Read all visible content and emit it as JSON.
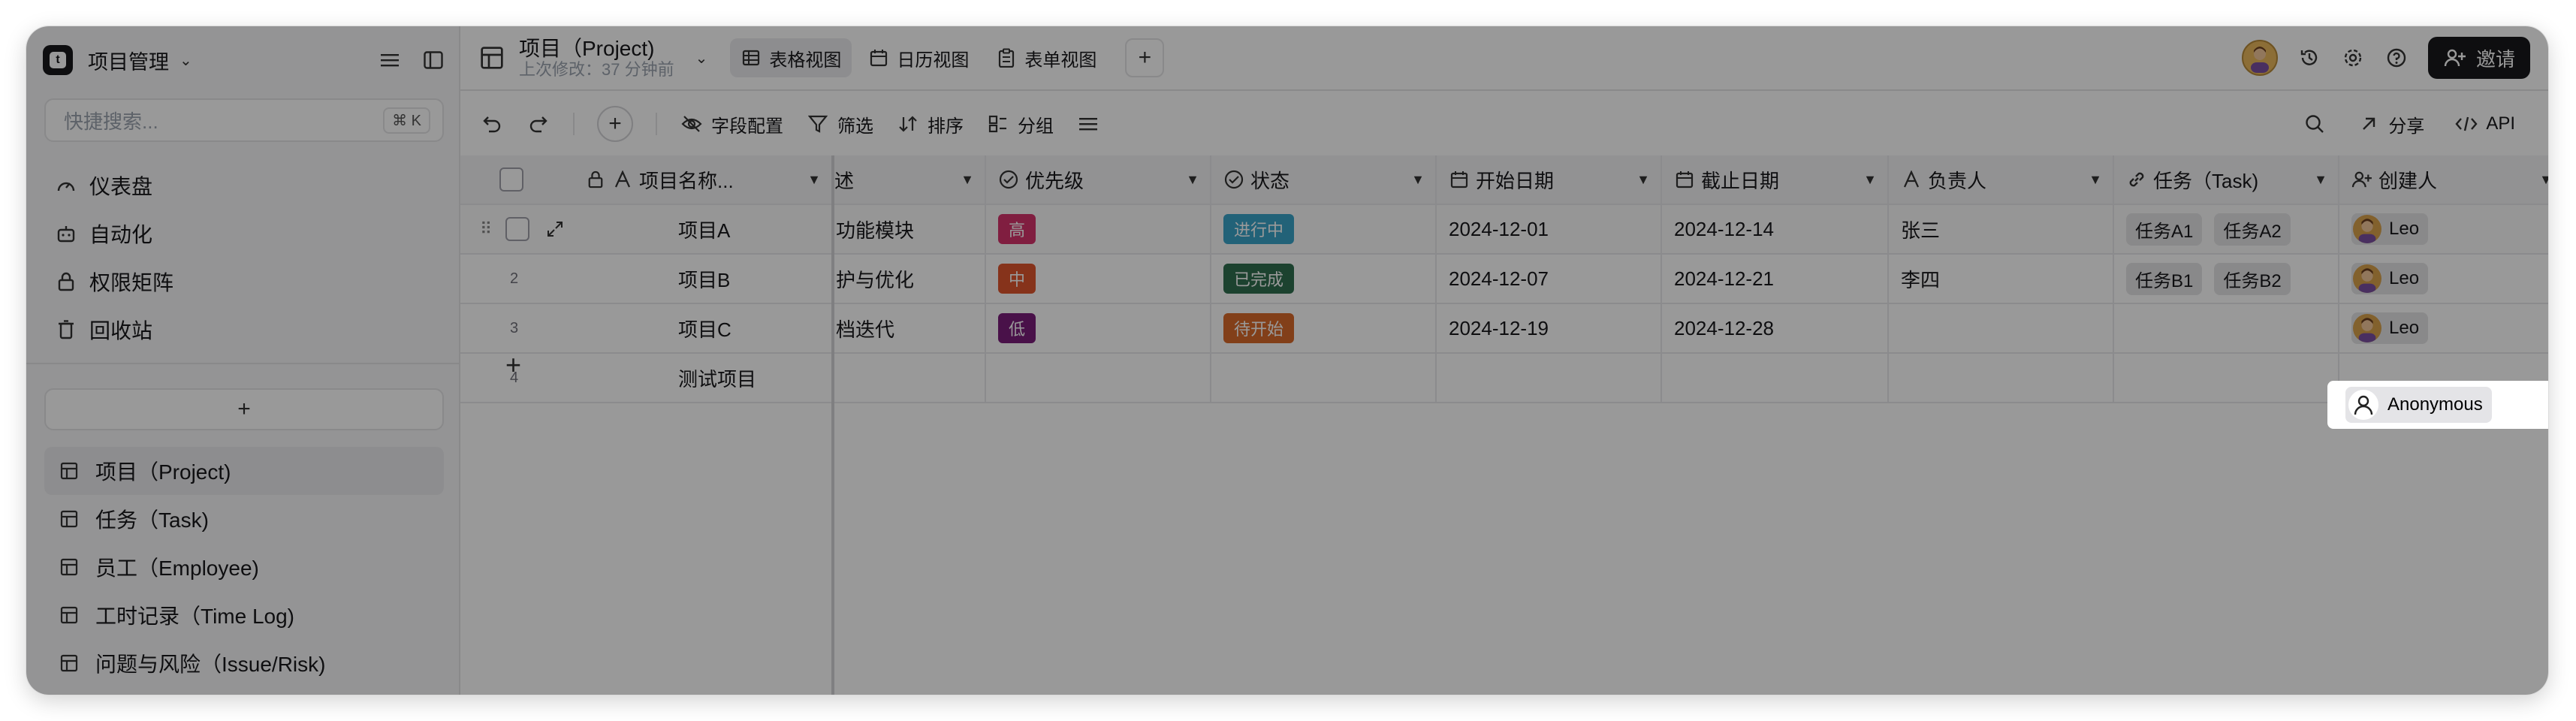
{
  "app": {
    "base_name": "项目管理"
  },
  "sidebar": {
    "search_placeholder": "快捷搜索...",
    "search_shortcut": "⌘ K",
    "nav": [
      {
        "label": "仪表盘",
        "icon": "dashboard-icon"
      },
      {
        "label": "自动化",
        "icon": "robot-icon"
      },
      {
        "label": "权限矩阵",
        "icon": "lock-icon"
      },
      {
        "label": "回收站",
        "icon": "trash-icon"
      }
    ],
    "add_label": "+",
    "tables": [
      {
        "label": "项目（Project)",
        "active": true
      },
      {
        "label": "任务（Task)"
      },
      {
        "label": "员工（Employee)"
      },
      {
        "label": "工时记录（Time Log)"
      },
      {
        "label": "问题与风险（Issue/Risk)"
      }
    ]
  },
  "header": {
    "table_title": "项目（Project)",
    "last_modified": "上次修改：37 分钟前",
    "views": [
      {
        "label": "表格视图",
        "active": true
      },
      {
        "label": "日历视图"
      },
      {
        "label": "表单视图"
      }
    ],
    "invite_label": "邀请"
  },
  "toolbar": {
    "fields_label": "字段配置",
    "filter_label": "筛选",
    "sort_label": "排序",
    "group_label": "分组",
    "share_label": "分享",
    "api_label": "API"
  },
  "grid": {
    "columns": [
      "项目名称...",
      "述",
      "优先级",
      "状态",
      "开始日期",
      "截止日期",
      "负责人",
      "任务（Task)",
      "创建人"
    ],
    "rows": [
      {
        "num": "1",
        "name": "项目A",
        "desc": "功能模块",
        "priority": "高",
        "status": "进行中",
        "start": "2024-12-01",
        "end": "2024-12-14",
        "owner": "张三",
        "tasks": [
          "任务A1",
          "任务A2"
        ],
        "creator": "Leo"
      },
      {
        "num": "2",
        "name": "项目B",
        "desc": "护与优化",
        "priority": "中",
        "status": "已完成",
        "start": "2024-12-07",
        "end": "2024-12-21",
        "owner": "李四",
        "tasks": [
          "任务B1",
          "任务B2"
        ],
        "creator": "Leo"
      },
      {
        "num": "3",
        "name": "项目C",
        "desc": "档迭代",
        "priority": "低",
        "status": "待开始",
        "start": "2024-12-19",
        "end": "2024-12-28",
        "owner": "",
        "tasks": [],
        "creator": "Leo"
      },
      {
        "num": "4",
        "name": "测试项目",
        "desc": "",
        "priority": "",
        "status": "",
        "start": "",
        "end": "",
        "owner": "",
        "tasks": [],
        "creator": ""
      }
    ],
    "add_row": "+"
  },
  "popover": {
    "user": "Anonymous"
  },
  "colors": {
    "priority_high": "#d6336c",
    "priority_mid": "#e0552e",
    "priority_low": "#7a1d7a",
    "status_in_progress": "#3aa3c9",
    "status_done": "#2f6f4f",
    "status_todo": "#d9692b"
  }
}
